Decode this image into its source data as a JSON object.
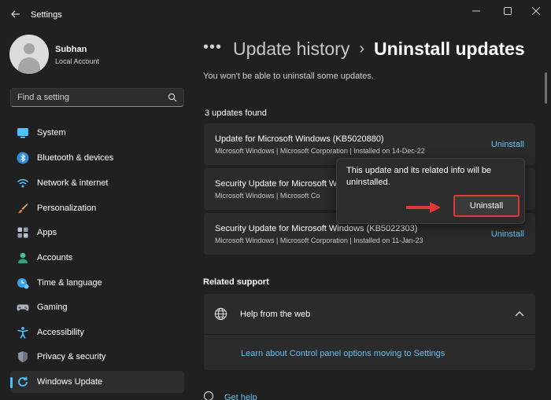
{
  "window": {
    "title": "Settings"
  },
  "user": {
    "name": "Subhan",
    "account_type": "Local Account"
  },
  "search": {
    "placeholder": "Find a setting"
  },
  "nav": {
    "items": [
      {
        "label": "System",
        "icon": "monitor-icon",
        "selected": false
      },
      {
        "label": "Bluetooth & devices",
        "icon": "bluetooth-icon",
        "selected": false
      },
      {
        "label": "Network & internet",
        "icon": "wifi-icon",
        "selected": false
      },
      {
        "label": "Personalization",
        "icon": "brush-icon",
        "selected": false
      },
      {
        "label": "Apps",
        "icon": "apps-icon",
        "selected": false
      },
      {
        "label": "Accounts",
        "icon": "person-icon",
        "selected": false
      },
      {
        "label": "Time & language",
        "icon": "clock-icon",
        "selected": false
      },
      {
        "label": "Gaming",
        "icon": "gamepad-icon",
        "selected": false
      },
      {
        "label": "Accessibility",
        "icon": "accessibility-icon",
        "selected": false
      },
      {
        "label": "Privacy & security",
        "icon": "shield-icon",
        "selected": false
      },
      {
        "label": "Windows Update",
        "icon": "windows-update-icon",
        "selected": true
      }
    ]
  },
  "breadcrumb": {
    "overflow": "•••",
    "separator": "›",
    "previous": "Update history",
    "current": "Uninstall updates"
  },
  "notice": "You won't be able to uninstall some updates.",
  "updates_count": "3 updates found",
  "updates": [
    {
      "title": "Update for Microsoft Windows (KB5020880)",
      "meta": "Microsoft Windows  |  Microsoft Corporation  |  Installed on 14-Dec-22",
      "action": "Uninstall"
    },
    {
      "title": "Security Update for Microsoft W",
      "meta": "Microsoft Windows  |  Microsoft Co",
      "action": ""
    },
    {
      "title": "Security Update for Microsoft Windows (KB5022303)",
      "meta": "Microsoft Windows  |  Microsoft Corporation  |  Installed on 11-Jan-23",
      "action": "Uninstall"
    }
  ],
  "flyout": {
    "message": "This update and its related info will be uninstalled.",
    "button": "Uninstall"
  },
  "related_support": {
    "heading": "Related support",
    "help_title": "Help from the web",
    "link": "Learn about Control panel options moving to Settings"
  },
  "get_help": "Get help",
  "colors": {
    "background": "#202020",
    "card": "#2b2b2b",
    "accent": "#4cc2ff",
    "link": "#67c1f5",
    "highlight": "#e0373a"
  }
}
